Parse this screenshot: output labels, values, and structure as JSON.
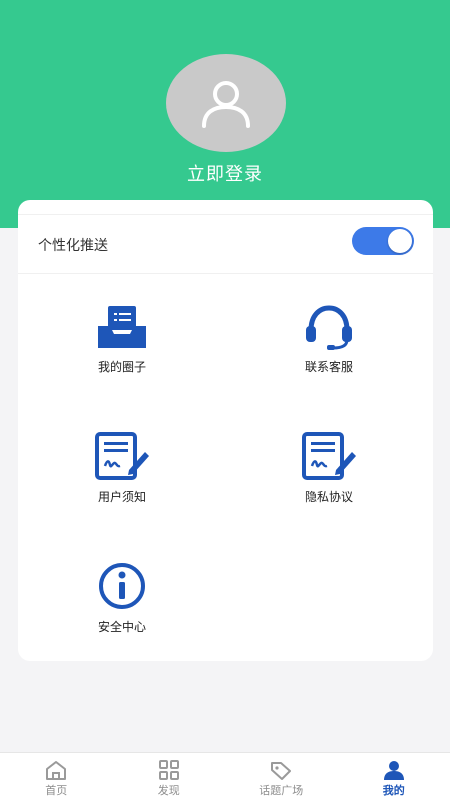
{
  "header": {
    "login_label": "立即登录"
  },
  "settings": {
    "personalized_push_label": "个性化推送",
    "personalized_push_enabled": true
  },
  "menu": [
    {
      "label": "我的圈子",
      "icon": "inbox-icon"
    },
    {
      "label": "联系客服",
      "icon": "headset-icon"
    },
    {
      "label": "用户须知",
      "icon": "document-sign-icon"
    },
    {
      "label": "隐私协议",
      "icon": "document-sign-icon"
    },
    {
      "label": "安全中心",
      "icon": "info-icon"
    }
  ],
  "tabbar": [
    {
      "label": "首页",
      "icon": "home-icon"
    },
    {
      "label": "发现",
      "icon": "grid-icon"
    },
    {
      "label": "话题广场",
      "icon": "tag-icon"
    },
    {
      "label": "我的",
      "icon": "user-icon",
      "active": true
    }
  ],
  "colors": {
    "header_bg": "#35c98f",
    "accent_blue": "#1e56b8",
    "toggle_on": "#3d7ae8"
  }
}
